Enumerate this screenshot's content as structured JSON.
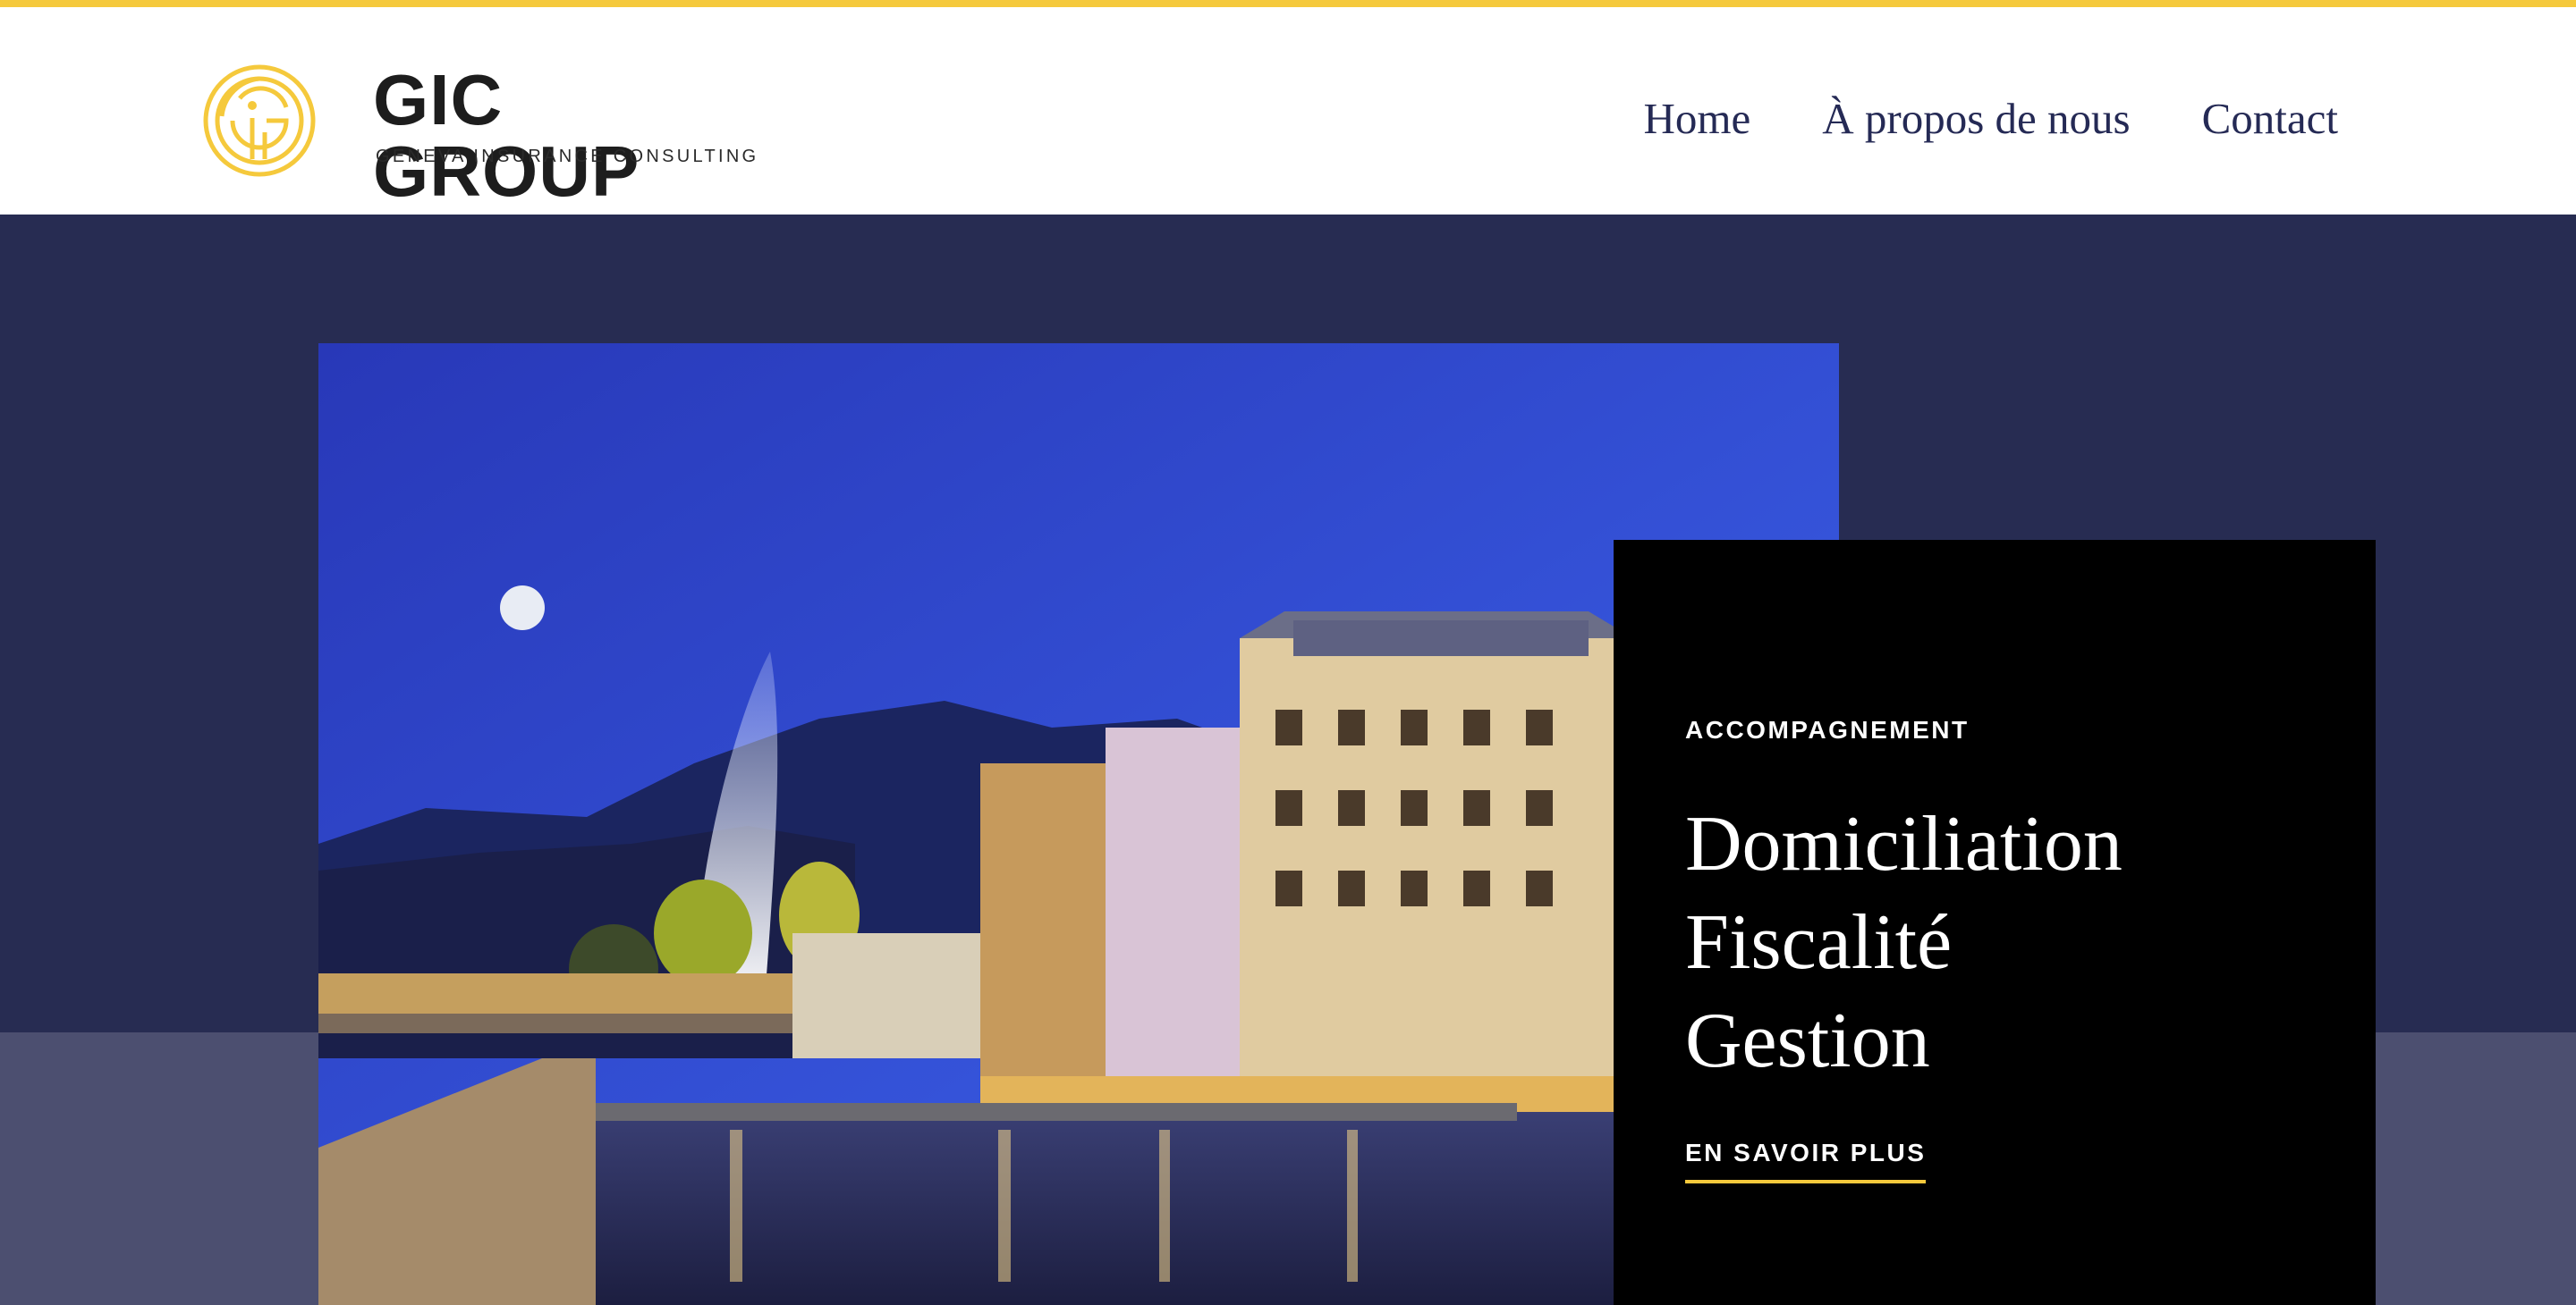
{
  "header": {
    "brand_name": "GIC GROUP",
    "tagline": "GENEVA INSURANCE CONSULTING",
    "nav": [
      {
        "label": "Home"
      },
      {
        "label": "À propos de nous"
      },
      {
        "label": "Contact"
      }
    ]
  },
  "hero": {
    "image_subject": "geneva-night-cityscape",
    "card": {
      "eyebrow": "ACCOMPAGNEMENT",
      "title_lines": [
        "Domiciliation",
        "Fiscalité",
        "Gestion"
      ],
      "cta_label": "EN SAVOIR PLUS"
    }
  },
  "colors": {
    "accent": "#f5c93c",
    "navy": "#272c52",
    "band": "#4c4f70",
    "nav_text": "#252a55",
    "card_bg": "#000000"
  }
}
